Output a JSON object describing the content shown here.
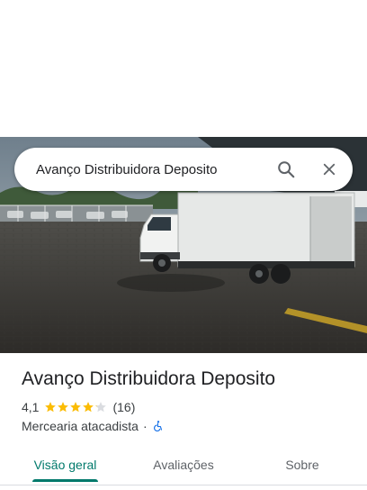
{
  "search": {
    "query": "Avanço Distribuidora Deposito",
    "search_icon": "search-icon",
    "close_icon": "close-icon"
  },
  "hero_photo": {
    "description_icon": "place-photo"
  },
  "place": {
    "name": "Avanço Distribuidora Deposito",
    "rating": "4,1",
    "rating_fraction": 0.82,
    "review_count": "(16)",
    "category": "Mercearia atacadista",
    "separator": "·",
    "accessibility_icon": "wheelchair-icon"
  },
  "tabs": [
    {
      "label": "Visão geral",
      "active": true
    },
    {
      "label": "Avaliações",
      "active": false
    },
    {
      "label": "Sobre",
      "active": false
    }
  ],
  "colors": {
    "accent": "#00796b",
    "star": "#fbbc04",
    "star_empty": "#dadce0",
    "accessibility": "#1a73e8"
  }
}
